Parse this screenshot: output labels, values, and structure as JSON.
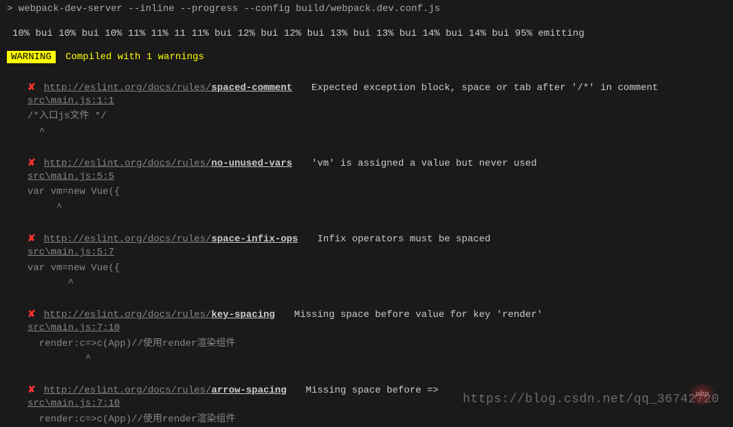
{
  "cmd": "> webpack-dev-server --inline --progress --config build/webpack.dev.conf.js",
  "progress": "10% bui 10% bui 10% 11% 11% 11 11% bui 12% bui 12% bui 13% bui 13% bui 14% bui 14% bui 95% emitting",
  "warning": {
    "badge": "WARNING",
    "text": "Compiled with 1 warnings"
  },
  "rule_base": "http://eslint.org/docs/rules/",
  "errors": [
    {
      "rule": "spaced-comment",
      "msg": "Expected exception block, space or tab after '/*' in comment",
      "loc": "src\\main.js:1:1",
      "code": "/*入口js文件 */",
      "caret": "  ^"
    },
    {
      "rule": "no-unused-vars",
      "msg": "'vm' is assigned a value but never used",
      "loc": "src\\main.js:5:5",
      "code": "var vm=new Vue({",
      "caret": "     ^"
    },
    {
      "rule": "space-infix-ops",
      "msg": "Infix operators must be spaced",
      "loc": "src\\main.js:5:7",
      "code": "var vm=new Vue({",
      "caret": "       ^"
    },
    {
      "rule": "key-spacing",
      "msg": "Missing space before value for key 'render'",
      "loc": "src\\main.js:7:10",
      "code": "  render:c=>c(App)//使用render渲染组件",
      "caret": "          ^"
    },
    {
      "rule": "arrow-spacing",
      "msg": "Missing space before =>",
      "loc": "src\\main.js:7:10",
      "code": "  render:c=>c(App)//使用render渲染组件",
      "caret": ""
    }
  ],
  "watermark": "https://blog.csdn.net/qq_36742720",
  "php": "php"
}
